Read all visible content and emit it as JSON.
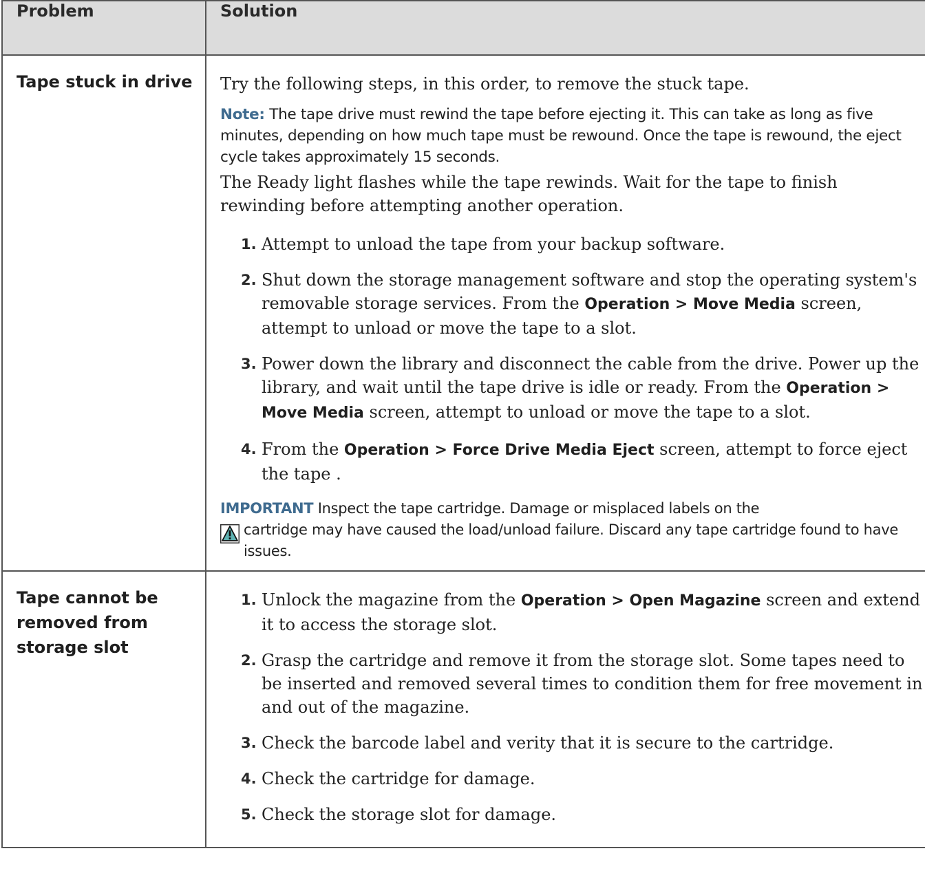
{
  "table": {
    "headers": {
      "problem": "Problem",
      "solution": "Solution"
    }
  },
  "rows": [
    {
      "problem": "Tape stuck in drive",
      "intro": "Try the following steps, in this order, to remove the stuck tape.",
      "note_label": "Note:",
      "note_text": "The tape drive must rewind the tape before ejecting it. This can take as long as five minutes, depending on how much tape must be rewound. Once the tape is rewound, the eject cycle takes approximately 15 seconds.",
      "ready_text": "The Ready light flashes while the tape rewinds. Wait for the tape to finish rewinding before attempting another operation.",
      "steps": [
        {
          "num": "1.",
          "text": "Attempt to unload the tape from your backup software."
        },
        {
          "num": "2.",
          "pre": "Shut down the storage management software and stop the operating system's removable storage services. From the ",
          "ui": "Operation > Move Media",
          "post": " screen, attempt to unload or move the tape to a slot."
        },
        {
          "num": "3.",
          "pre": "Power down the library and disconnect the cable from the drive. Power up the library, and wait until the tape drive is idle or ready. From the ",
          "ui": "Operation > Move Media",
          "post": " screen, attempt to unload or move the tape to a slot."
        },
        {
          "num": "4.",
          "pre": "From the ",
          "ui": "Operation > Force Drive Media Eject",
          "post": " screen, attempt to force eject the tape ."
        }
      ],
      "important_label": "IMPORTANT",
      "important_first": "Inspect the tape cartridge. Damage or misplaced labels on the",
      "important_rest": "cartridge may have caused the load/unload failure. Discard any tape cartridge found to have issues.",
      "important_icon": "warning-triangle-icon"
    },
    {
      "problem": "Tape cannot be removed from storage slot",
      "steps": [
        {
          "num": "1.",
          "pre": " Unlock the magazine from the ",
          "ui": "Operation > Open Magazine",
          "post": " screen and extend it to access the storage slot."
        },
        {
          "num": "2.",
          "text": "Grasp the cartridge and remove it from the storage slot. Some tapes need to be inserted and removed several times to condition them for free movement in and out of the magazine."
        },
        {
          "num": "3.",
          "text": "Check the barcode label and verity that it is secure to the cartridge."
        },
        {
          "num": "4.",
          "text": "Check the cartridge for damage."
        },
        {
          "num": "5.",
          "text": "Check the storage slot for damage."
        }
      ]
    }
  ],
  "colors": {
    "header_bg": "#dcdcdc",
    "accent": "#3f6b8f",
    "border": "#555555",
    "warning_fill": "#5fb3b3"
  }
}
